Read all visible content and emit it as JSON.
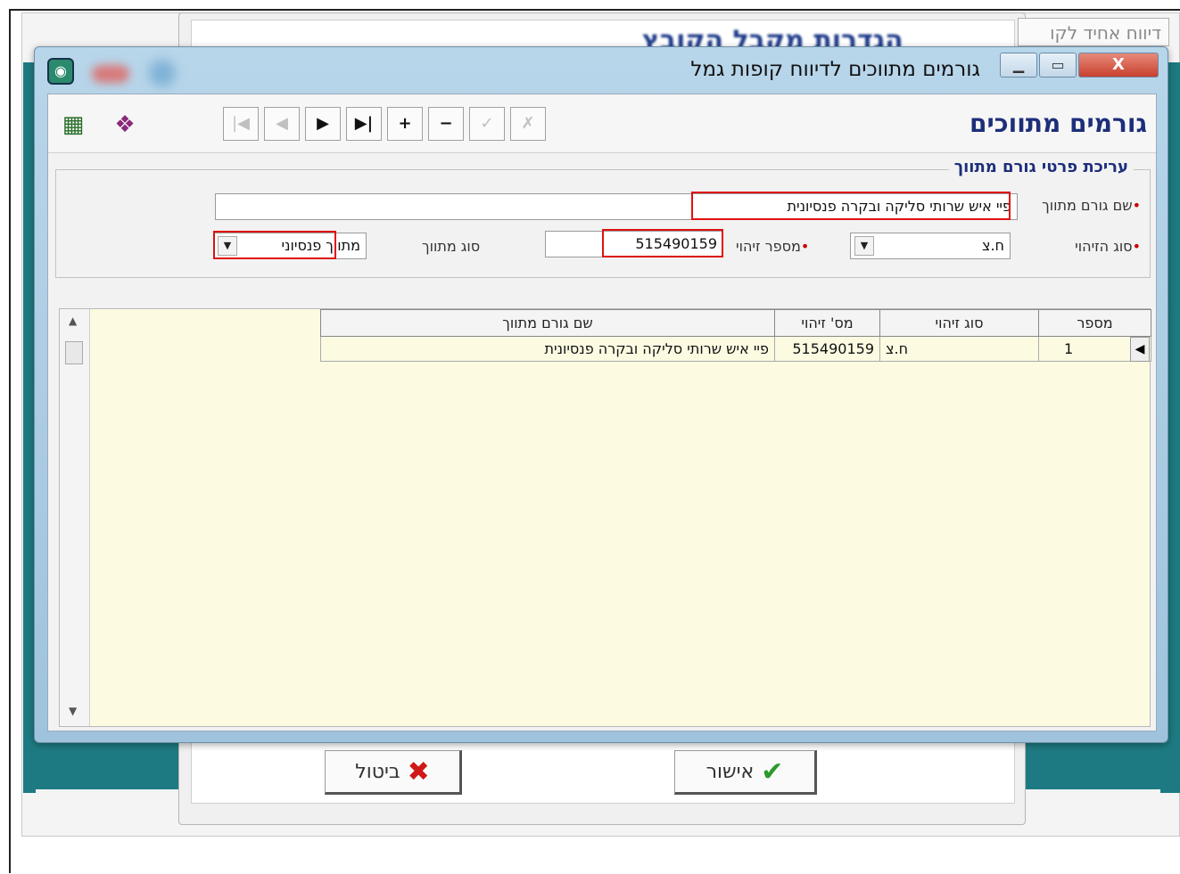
{
  "background": {
    "top_right_text": "דיווח אחיד לקו",
    "header_title_blurred": "הגדרות מקבל הקובץ"
  },
  "window": {
    "title": "גורמים מתווכים לדיווח קופות גמל",
    "close_label": "X"
  },
  "toolbar": {
    "heading": "גורמים מתווכים",
    "nav": [
      "|◀",
      "◀",
      "▶",
      "▶|",
      "+",
      "−",
      "✓",
      "✗"
    ]
  },
  "form": {
    "group_title": "עריכת פרטי גורם מתווך",
    "name_label": "שם גורם מתווך",
    "name_value": "פיי איש שרותי סליקה ובקרה פנסיונית",
    "id_type_label": "סוג הזיהוי",
    "id_type_value": "ח.צ",
    "id_number_label": "מספר זיהוי",
    "id_number_value": "515490159",
    "intermediary_type_label": "סוג מתווך",
    "intermediary_type_value": "מתווך פנסיוני"
  },
  "grid": {
    "columns": [
      "מספר",
      "סוג זיהוי",
      "מס' זיהוי",
      "שם גורם מתווך"
    ],
    "rows": [
      [
        "1",
        "ח.צ",
        "515490159",
        "פיי איש שרותי סליקה ובקרה פנסיונית"
      ]
    ]
  },
  "buttons": {
    "ok": "אישור",
    "cancel": "ביטול"
  }
}
